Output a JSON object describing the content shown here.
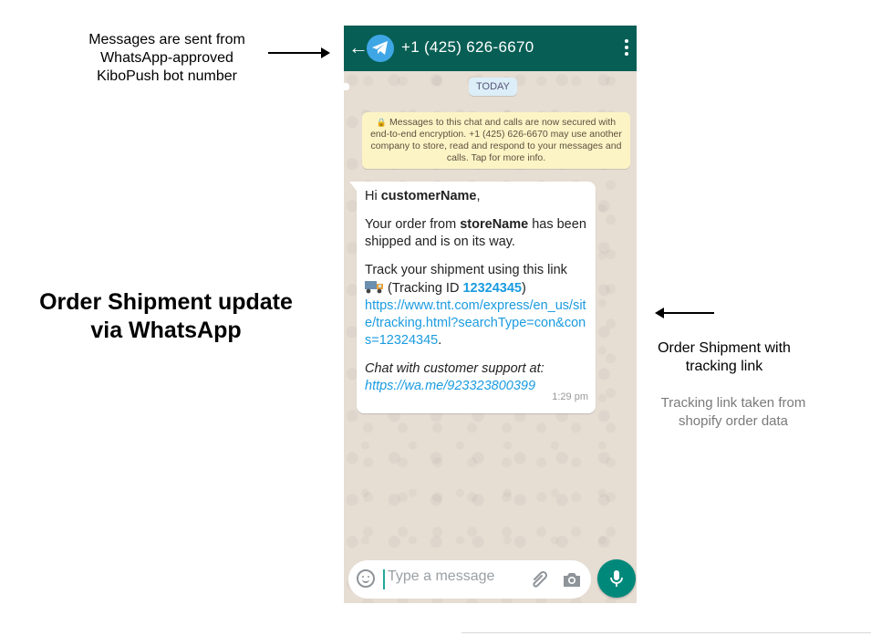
{
  "annotations": {
    "top_left": [
      "Messages are sent from",
      "WhatsApp-approved",
      "KiboPush bot number"
    ],
    "headline": [
      "Order Shipment update",
      "via WhatsApp"
    ],
    "right": [
      "Order Shipment with",
      "tracking link"
    ],
    "right_note": [
      "Tracking link taken from",
      "shopify order data"
    ]
  },
  "header": {
    "contact": "+1 (425) 626-6670"
  },
  "chat": {
    "date": "TODAY",
    "encryption_notice": "Messages to this chat and calls are now secured with end-to-end encryption. +1 (425) 626-6670 may use another company to store, read and respond to your messages and calls. Tap for more info.",
    "message": {
      "greeting_prefix": "Hi ",
      "customer_name": "customerName",
      "greeting_suffix": ",",
      "order_prefix": "Your order from ",
      "store_name": "storeName",
      "order_suffix": " has been shipped and is on its way.",
      "track_intro": "Track your shipment using this link",
      "tracking_prefix": "(Tracking ID ",
      "tracking_id": "12324345",
      "tracking_suffix": ")",
      "tracking_url": "https://www.tnt.com/express/en_us/site/tracking.html?searchType=con&cons=12324345",
      "url_suffix": ".",
      "support_text": "Chat with customer support at:",
      "support_url": "https://wa.me/923323800399",
      "time": "1:29 pm"
    }
  },
  "composer": {
    "placeholder": "Type a message"
  },
  "icons": {
    "back": "back-arrow-icon",
    "avatar": "telegram-logo-icon",
    "menu": "more-vert-icon",
    "truck": "truck-icon",
    "emoji": "emoji-icon",
    "attach": "paperclip-icon",
    "camera": "camera-icon",
    "mic": "mic-icon"
  },
  "colors": {
    "appbar": "#075e54",
    "link": "#1a9be0",
    "mic_button": "#00897b"
  }
}
